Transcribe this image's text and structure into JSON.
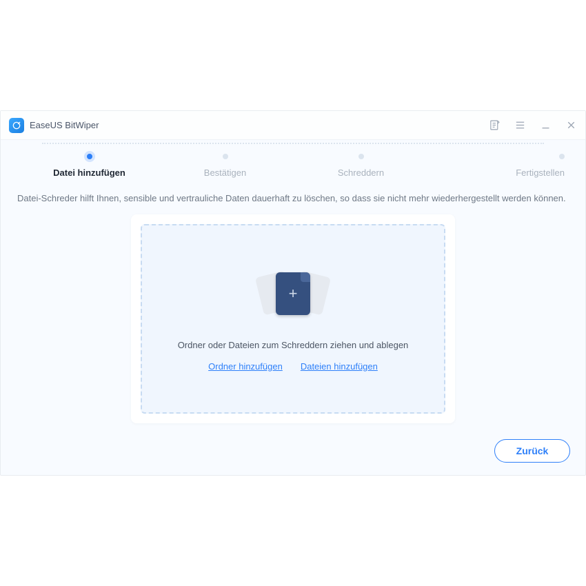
{
  "app": {
    "title": "EaseUS BitWiper"
  },
  "stepper": {
    "steps": [
      {
        "label": "Datei hinzufügen",
        "active": true
      },
      {
        "label": "Bestätigen",
        "active": false
      },
      {
        "label": "Schreddern",
        "active": false
      },
      {
        "label": "Fertigstellen",
        "active": false
      }
    ]
  },
  "description": "Datei-Schreder hilft Ihnen, sensible und vertrauliche Daten dauerhaft zu löschen, so dass sie nicht mehr wiederhergestellt werden können.",
  "dropzone": {
    "hint": "Ordner oder Dateien zum Schreddern ziehen und ablegen",
    "add_folder": "Ordner hinzufügen",
    "add_files": "Dateien hinzufügen"
  },
  "footer": {
    "back": "Zurück"
  }
}
